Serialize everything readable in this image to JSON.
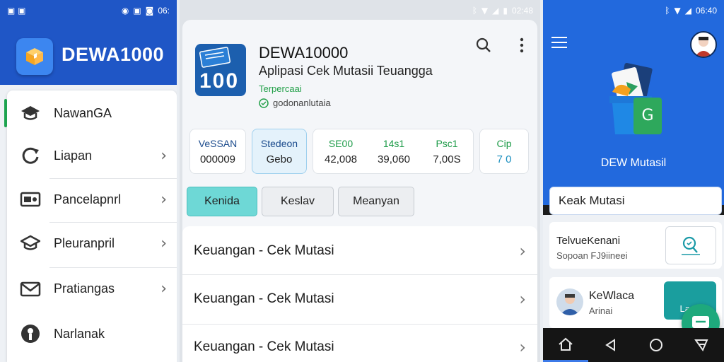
{
  "screen1": {
    "status": {
      "time": "06:"
    },
    "app_title": "DEWA1000",
    "menu": [
      {
        "label": "NawanGA",
        "icon": "graduation-cap-icon",
        "chevron": false
      },
      {
        "label": "Liapan",
        "icon": "refresh-icon",
        "chevron": true
      },
      {
        "label": "Pancelapnrl",
        "icon": "ticket-icon",
        "chevron": true
      },
      {
        "label": "Pleuranpril",
        "icon": "graduation-cap-icon",
        "chevron": true
      },
      {
        "label": "Pratiangas",
        "icon": "mail-icon",
        "chevron": true
      },
      {
        "label": "Narlanak",
        "icon": "user-circle-icon",
        "chevron": false
      }
    ]
  },
  "screen2": {
    "status": {
      "time": "02:48"
    },
    "app": {
      "name": "DEWA10000",
      "subtitle": "Aplipasi Cek Mutasii Teuangga",
      "tag": "Terpercaai",
      "verified": "godonanlutaia",
      "logo_text": "100"
    },
    "stats": [
      {
        "h": "VeSSAN",
        "v": "000009"
      },
      {
        "h": "Stedeon",
        "v": "Gebo"
      },
      {
        "h": "SE00",
        "v": "42,008"
      },
      {
        "h": "14s1",
        "v": "39,060"
      },
      {
        "h": "Psc1",
        "v": "7,00S"
      },
      {
        "h": "Cip",
        "v": "7 0"
      }
    ],
    "tabs": [
      "Kenida",
      "Keslav",
      "Meanyan"
    ],
    "rows": [
      "Keuangan - Cek Mutasi",
      "Keuangan - Cek Mutasi",
      "Keuangan - Cek Mutasi"
    ]
  },
  "screen3": {
    "status": {
      "time": "06:40"
    },
    "header_title": "DEW Mutasil",
    "search_card": "Keak Mutasi",
    "card1": {
      "title": "TelvueKenani",
      "desc": "Sopoan FJ9iineei"
    },
    "card2": {
      "title": "KeWlaca",
      "desc": "Arinai",
      "button": "Laen"
    }
  },
  "colors": {
    "primary_blue": "#1f56c6",
    "header_blue": "#2269dd",
    "accent_teal": "#6ed8d6",
    "green": "#1d9b48",
    "fab_green": "#1ea97c"
  }
}
